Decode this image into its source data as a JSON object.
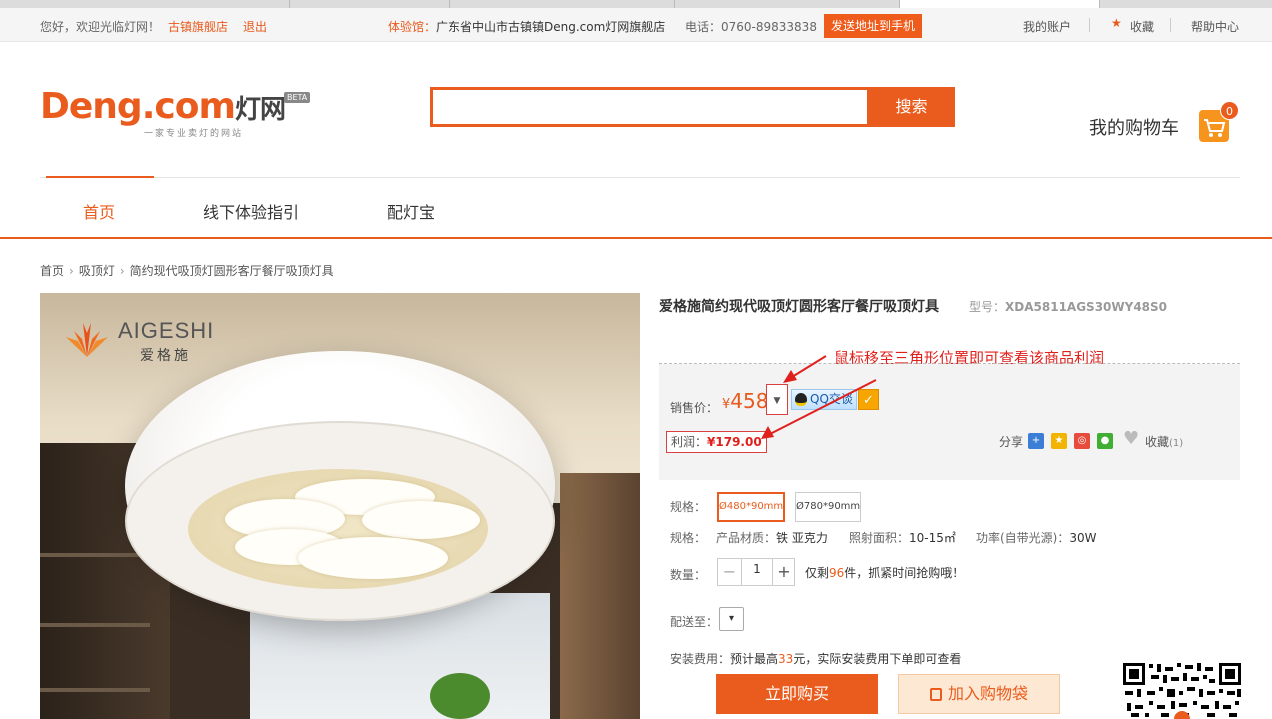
{
  "topbar": {
    "welcome": "您好，欢迎光临灯网！",
    "store_link": "古镇旗舰店",
    "logout": "退出",
    "experience_label": "体验馆：",
    "experience_address": "广东省中山市古镇镇Deng.com灯网旗舰店",
    "phone": "电话：0760-89833838",
    "send_to_phone": "发送地址到手机",
    "my_account": "我的账户",
    "favorites": "收藏",
    "help_center": "帮助中心"
  },
  "header": {
    "logo_text": "Deng.com",
    "logo_cn": "灯网",
    "logo_tagline": "一家专业卖灯的网站",
    "logo_badge": "BETA",
    "search_value": "",
    "search_button": "搜索",
    "cart_label": "我的购物车",
    "cart_count": "0"
  },
  "nav": {
    "items": [
      {
        "label": "首页"
      },
      {
        "label": "线下体验指引"
      },
      {
        "label": "配灯宝"
      }
    ]
  },
  "breadcrumb": [
    "首页",
    "吸顶灯",
    "简约现代吸顶灯圆形客厅餐厅吸顶灯具"
  ],
  "product_image": {
    "brand_name": "AIGESHI",
    "brand_cn": "爱格施"
  },
  "product": {
    "title": "爱格施简约现代吸顶灯圆形客厅餐厅吸顶灯具",
    "model_label": "型号：",
    "model_value": "XDA5811AGS30WY48S0",
    "annotation": "鼠标移至三角形位置即可查看该商品利润",
    "price_label": "销售价：",
    "price_symbol": "¥",
    "price_value": "458",
    "qq_label": "QQ交谈",
    "profit_label": "利润：",
    "profit_value": "¥179.00",
    "share_label": "分享",
    "fav_label": "收藏",
    "fav_count": "(1)",
    "spec_label": "规格：",
    "spec_options": [
      "Ø480*90mm",
      "Ø780*90mm"
    ],
    "attrs_label": "规格：",
    "attr_material_label": "产品材质：",
    "attr_material_value": "铁 亚克力",
    "attr_area_label": "照射面积：",
    "attr_area_value": "10-15㎡",
    "attr_power_label": "功率(自带光源)：",
    "attr_power_value": "30W",
    "qty_label": "数量：",
    "qty_value": "1",
    "stock_prefix": "仅剩",
    "stock_count": "96",
    "stock_suffix": "件，抓紧时间抢购哦！",
    "ship_label": "配送至：",
    "install_label": "安装费用：",
    "install_prefix": "预计最高",
    "install_amount": "33",
    "install_suffix": "元，实际安装费用下单即可查看",
    "buy_now": "立即购买",
    "add_to_bag": "加入购物袋"
  },
  "colors": {
    "accent": "#ea5c1d",
    "annotation_red": "#e0201b"
  }
}
